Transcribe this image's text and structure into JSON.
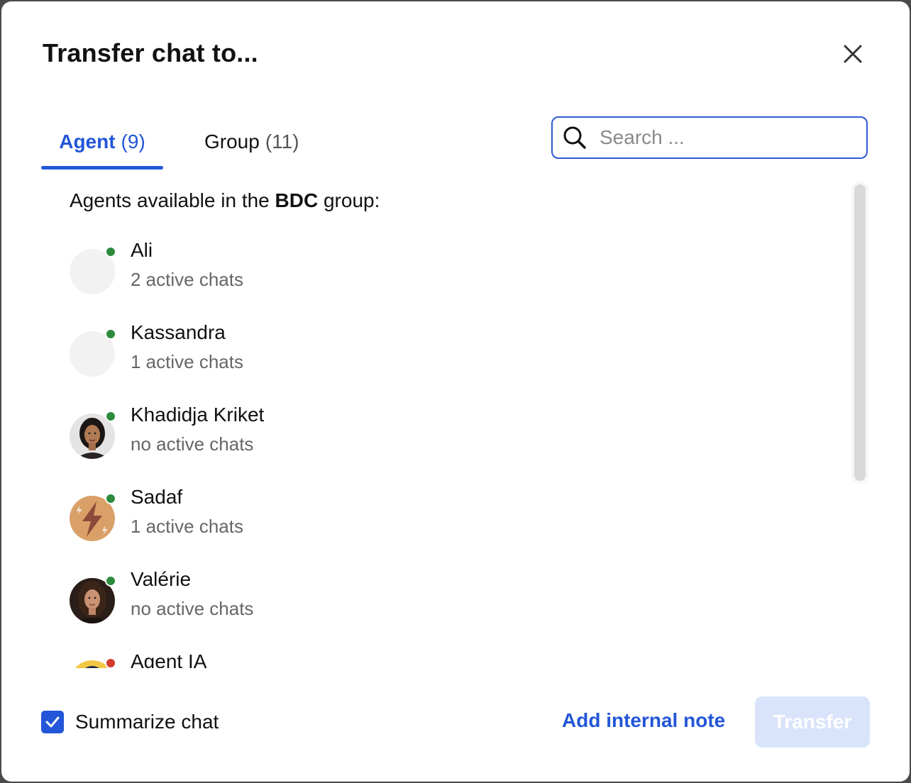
{
  "dialog": {
    "title": "Transfer chat to..."
  },
  "tabs": [
    {
      "label": "Agent",
      "count": "(9)",
      "active": true
    },
    {
      "label": "Group",
      "count": "(11)",
      "active": false
    }
  ],
  "search": {
    "placeholder": "Search ...",
    "value": ""
  },
  "list": {
    "heading_prefix": "Agents available in the",
    "heading_group": "BDC",
    "heading_suffix": "group:",
    "agents": [
      {
        "name": "Ali",
        "status": "2 active chats",
        "presence": "online",
        "avatar": "placeholder"
      },
      {
        "name": "Kassandra",
        "status": "1 active chats",
        "presence": "online",
        "avatar": "placeholder"
      },
      {
        "name": "Khadidja Kriket",
        "status": "no active chats",
        "presence": "online",
        "avatar": "photo"
      },
      {
        "name": "Sadaf",
        "status": "1 active chats",
        "presence": "online",
        "avatar": "lightning-logo"
      },
      {
        "name": "Valérie",
        "status": "no active chats",
        "presence": "online",
        "avatar": "photo"
      },
      {
        "name": "Agent IA",
        "status": "",
        "presence": "offline",
        "avatar": "illustration"
      }
    ]
  },
  "footer": {
    "summarize_label": "Summarize chat",
    "summarize_checked": true,
    "note_link": "Add internal note",
    "transfer_label": "Transfer",
    "transfer_enabled": false
  },
  "colors": {
    "accent": "#2356d8",
    "online": "#2e8b3e",
    "offline": "#d23b2c",
    "transfer_disabled_bg": "#d9e4fa"
  }
}
